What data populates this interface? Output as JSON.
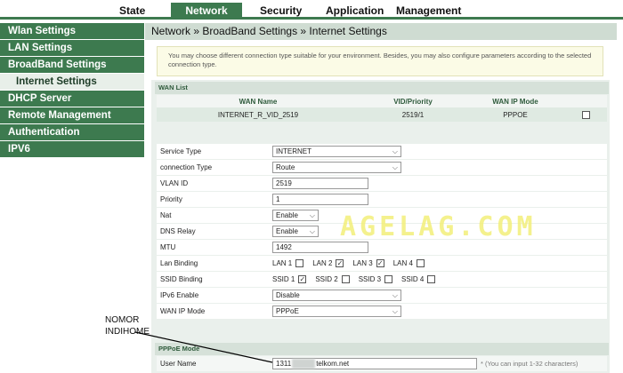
{
  "topnav": {
    "tabs": [
      "State",
      "Network",
      "Security",
      "Application",
      "Management"
    ],
    "active": "Network"
  },
  "sidebar": {
    "items": [
      {
        "label": "Wlan Settings"
      },
      {
        "label": "LAN Settings"
      },
      {
        "label": "BroadBand Settings"
      },
      {
        "label": "Internet Settings"
      },
      {
        "label": "DHCP Server"
      },
      {
        "label": "Remote Management"
      },
      {
        "label": "Authentication"
      },
      {
        "label": "IPV6"
      }
    ]
  },
  "breadcrumb": "Network » BroadBand Settings » Internet Settings",
  "info_text": "You may choose different connection type suitable for your environment. Besides, you may also configure parameters according to the selected connection type.",
  "wan_list": {
    "title": "WAN List",
    "headers": [
      "WAN Name",
      "VID/Priority",
      "WAN IP Mode"
    ],
    "row": {
      "name": "INTERNET_R_VID_2519",
      "vid": "2519/1",
      "mode": "PPPOE"
    }
  },
  "form": {
    "service_type": {
      "label": "Service Type",
      "value": "INTERNET"
    },
    "connection_type": {
      "label": "connection Type",
      "value": "Route"
    },
    "vlan_id": {
      "label": "VLAN ID",
      "value": "2519"
    },
    "priority": {
      "label": "Priority",
      "value": "1"
    },
    "nat": {
      "label": "Nat",
      "value": "Enable"
    },
    "dns_relay": {
      "label": "DNS Relay",
      "value": "Enable"
    },
    "mtu": {
      "label": "MTU",
      "value": "1492"
    },
    "lan_binding": {
      "label": "Lan Binding",
      "options": [
        "LAN 1",
        "LAN 2",
        "LAN 3",
        "LAN 4"
      ],
      "checked": [
        false,
        true,
        true,
        false
      ]
    },
    "ssid_binding": {
      "label": "SSID Binding",
      "options": [
        "SSID 1",
        "SSID 2",
        "SSID 3",
        "SSID 4"
      ],
      "checked": [
        true,
        false,
        false,
        false
      ]
    },
    "ipv6_enable": {
      "label": "IPv6 Enable",
      "value": "Disable"
    },
    "wan_ip_mode": {
      "label": "WAN IP Mode",
      "value": "PPPoE"
    }
  },
  "pppoe": {
    "title": "PPPoE Mode",
    "user_label": "User Name",
    "user_prefix": "1311",
    "user_suffix": "telkom.net",
    "user_hint": "* (You can input 1-32 characters)"
  },
  "annotation": {
    "line1": "NOMOR",
    "line2": "INDIHOME"
  },
  "watermark": "AGELAG.COM",
  "colors": {
    "primary": "#3d7a4f",
    "panel": "#eaf0ec",
    "info_bg": "#fbfbe6"
  }
}
